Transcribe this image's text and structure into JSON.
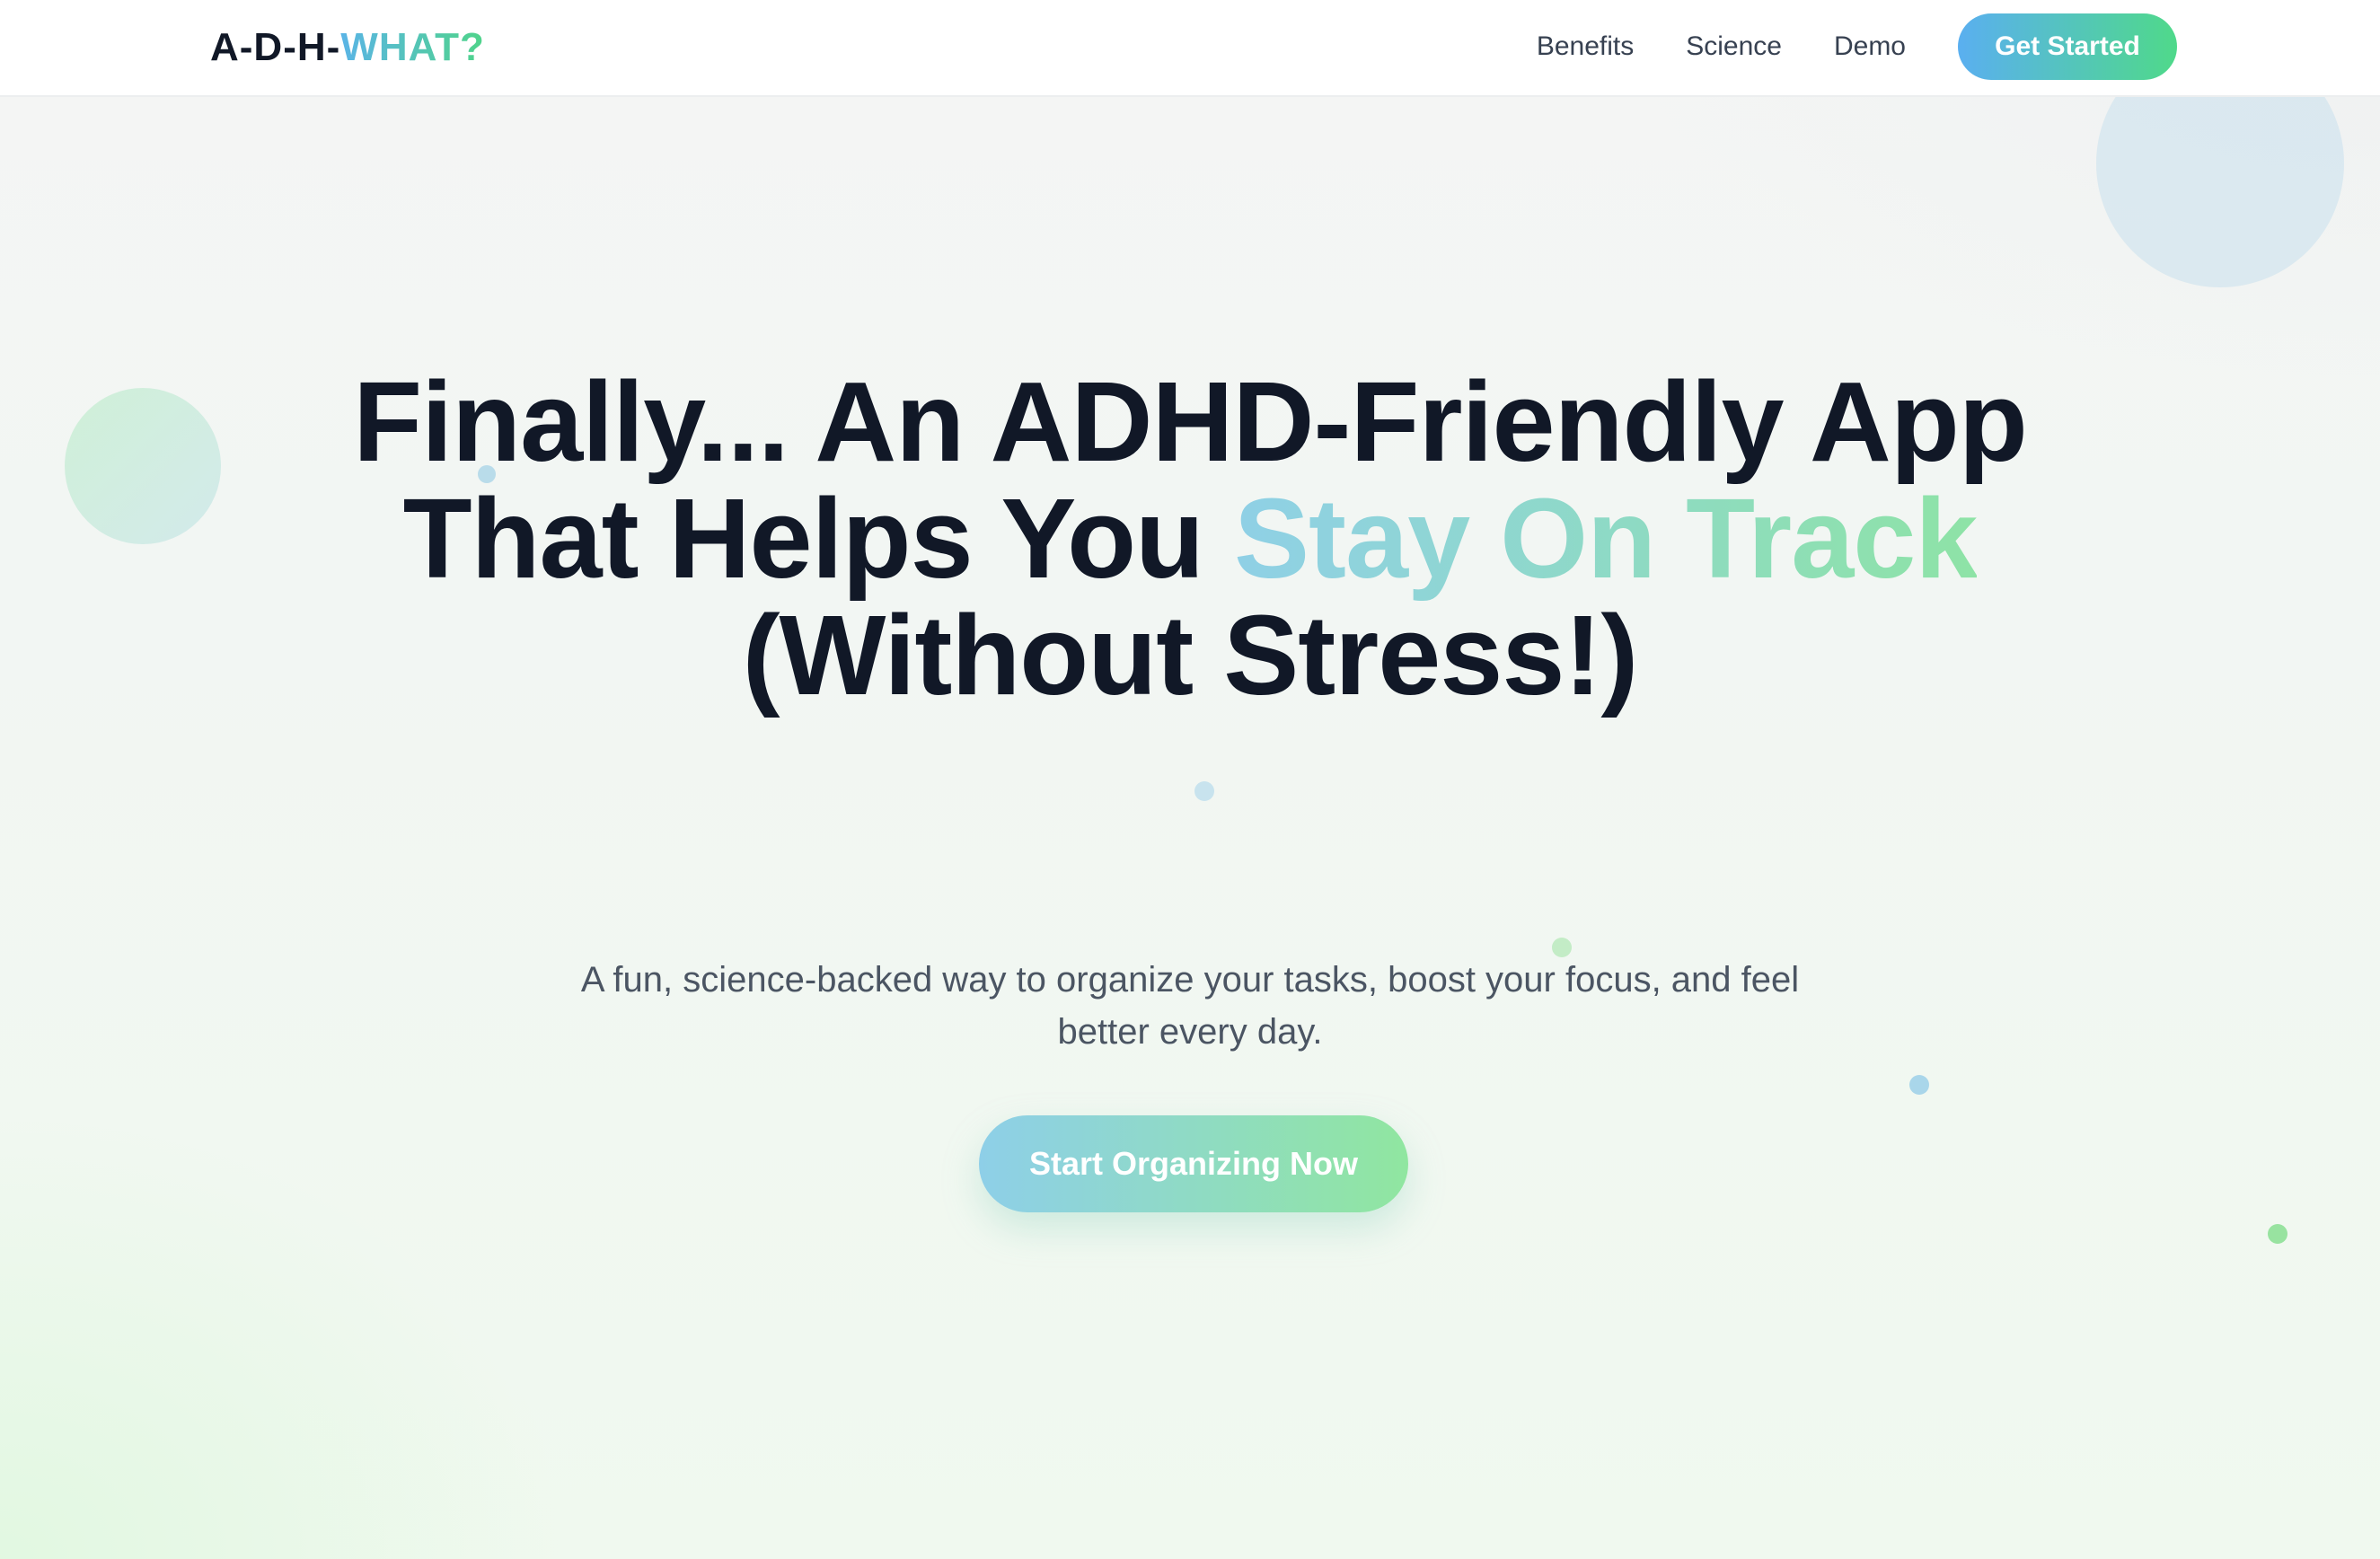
{
  "nav": {
    "logo": {
      "part1": "A-D-H-",
      "part2": "WHAT?"
    },
    "links": [
      "Benefits",
      "Science",
      "Demo"
    ],
    "cta_label": "Get Started"
  },
  "hero": {
    "headline": {
      "before": "Finally... An ADHD-Friendly App That Helps You ",
      "highlight": "Stay On Track",
      "after": " (Without Stress!)"
    },
    "subtitle": "A fun, science-backed way to organize your tasks, boost your focus, and feel better every day.",
    "cta_label": "Start Organizing Now"
  },
  "colors": {
    "brand_gradient_start": "#5ab4e6",
    "brand_gradient_end": "#4fd48a",
    "highlight_start": "#8fd0e6",
    "highlight_end": "#8ee3a6",
    "headline_text": "#111827",
    "body_text": "#4b5563"
  }
}
